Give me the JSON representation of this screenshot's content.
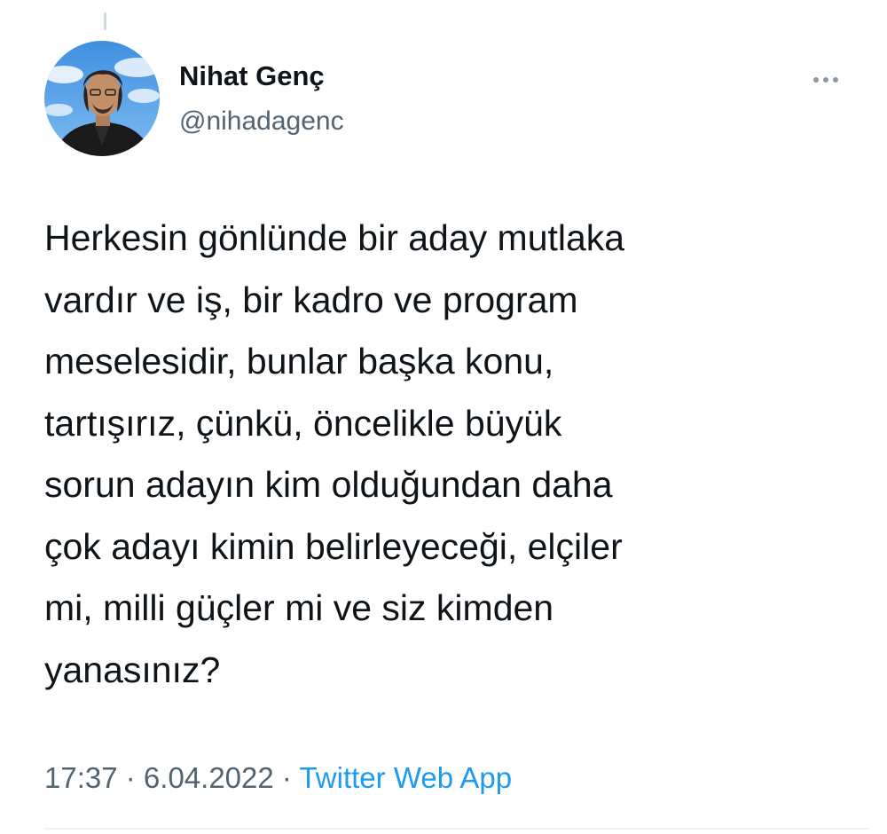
{
  "tweet": {
    "author": {
      "name": "Nihat Genç",
      "handle": "@nihadagenc",
      "avatar_icon": "profile-photo"
    },
    "more_icon": "ellipsis-icon",
    "text_lines": [
      "Herkesin gönlünde bir aday mutlaka",
      "vardır ve iş, bir kadro ve program",
      "meselesidir, bunlar başka konu,",
      "tartışırız, çünkü, öncelikle büyük",
      "sorun adayın kim olduğundan daha",
      "çok adayı kimin belirleyeceği, elçiler",
      "mi, milli güçler mi ve siz kimden",
      "yanasınız?"
    ],
    "meta": {
      "time": "17:37",
      "separator": " · ",
      "date": "6.04.2022",
      "source": "Twitter Web App"
    }
  },
  "colors": {
    "text_primary": "#0f1419",
    "text_secondary": "#536471",
    "link": "#1d9bf0",
    "divider": "#eff3f4"
  }
}
